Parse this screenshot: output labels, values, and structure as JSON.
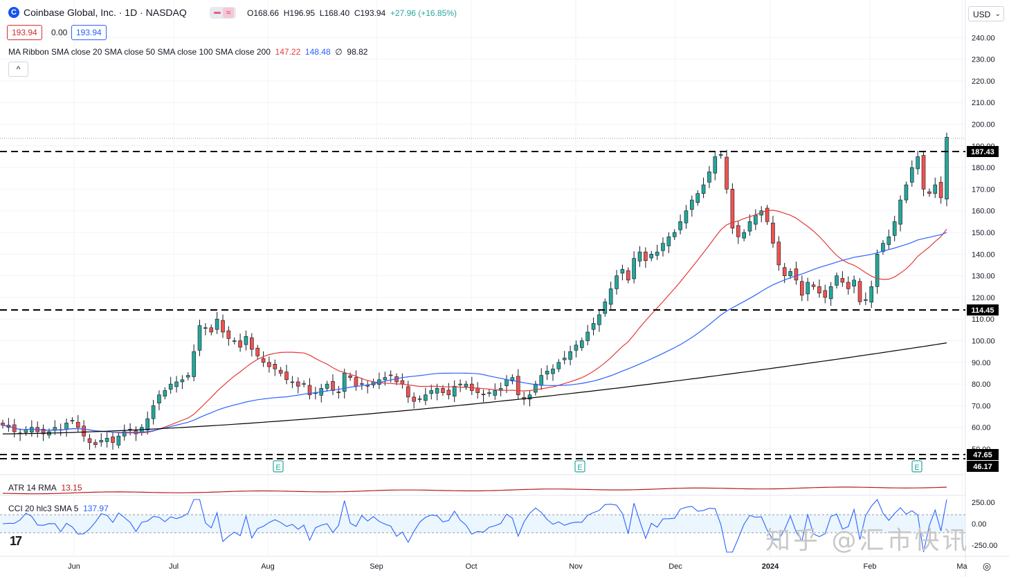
{
  "header": {
    "logo_glyph": "C",
    "symbol_title": "Coinbase Global, Inc. · 1D · NASDAQ",
    "ohlc": {
      "open_label": "O",
      "open": "168.66",
      "high_label": "H",
      "high": "196.95",
      "low_label": "L",
      "low": "168.40",
      "close_label": "C",
      "close": "193.94",
      "change": "+27.96 (+16.85%)"
    },
    "bid": "193.94",
    "spread": "0.00",
    "ask": "193.94",
    "ma_ribbon_label": "MA Ribbon SMA close 20 SMA close 50 SMA close 100 SMA close 200",
    "ma_values": [
      "147.22",
      "148.48",
      "∅",
      "98.82"
    ],
    "collapse_icon": "^",
    "currency": "USD"
  },
  "colors": {
    "up": "#26a69a",
    "down": "#ef5350",
    "sma20": "#e53935",
    "sma50": "#2962ff",
    "sma200": "#000000",
    "atr": "#b71c1c",
    "cci": "#2962ff"
  },
  "chart_data": {
    "type": "candlestick",
    "price_axis": {
      "ticks": [
        50,
        60,
        70,
        80,
        90,
        100,
        110,
        120,
        130,
        140,
        150,
        160,
        170,
        180,
        190,
        200,
        210,
        220,
        230,
        240
      ],
      "tick_labels": [
        "50.00",
        "60.00",
        "70.00",
        "80.00",
        "90.00",
        "100.00",
        "110.00",
        "120.00",
        "130.00",
        "140.00",
        "150.00",
        "160.00",
        "170.00",
        "180.00",
        "190.00",
        "200.00",
        "210.00",
        "220.00",
        "230.00",
        "240.00"
      ]
    },
    "time_axis": {
      "labels": [
        "Jun",
        "Jul",
        "Aug",
        "Sep",
        "Oct",
        "Nov",
        "Dec",
        "2024",
        "Feb",
        "Ma"
      ]
    },
    "horizontal_levels": [
      {
        "value": 187.43,
        "label": "187.43"
      },
      {
        "value": 114.45,
        "label": "114.45"
      },
      {
        "value": 47.65,
        "label": "47.65"
      },
      {
        "value": 46.17,
        "label": "46.17"
      }
    ],
    "earnings_markers": [
      "E",
      "E",
      "E"
    ],
    "candles_close": [
      61,
      60,
      58,
      57,
      59,
      60,
      58,
      57,
      58,
      60,
      59,
      62,
      63,
      60,
      56,
      53,
      52,
      54,
      55,
      53,
      56,
      58,
      59,
      57,
      60,
      64,
      70,
      75,
      77,
      80,
      81,
      82,
      84,
      95,
      107,
      106,
      104,
      110,
      104,
      101,
      100,
      97,
      102,
      96,
      93,
      90,
      88,
      87,
      85,
      82,
      81,
      79,
      80,
      75,
      76,
      78,
      80,
      77,
      76,
      85,
      83,
      79,
      80,
      79,
      81,
      82,
      83,
      84,
      81,
      80,
      74,
      72,
      73,
      75,
      77,
      78,
      76,
      75,
      79,
      80,
      80,
      77,
      76,
      75,
      76,
      77,
      78,
      82,
      83,
      75,
      73,
      75,
      80,
      84,
      86,
      87,
      90,
      92,
      95,
      98,
      100,
      104,
      108,
      112,
      118,
      124,
      130,
      133,
      128,
      138,
      141,
      137,
      140,
      141,
      145,
      148,
      150,
      155,
      160,
      165,
      168,
      172,
      178,
      185,
      186,
      170,
      152,
      148,
      150,
      155,
      158,
      160,
      155,
      145,
      135,
      130,
      132,
      128,
      121,
      127,
      125,
      122,
      120,
      125,
      130,
      127,
      124,
      128,
      118,
      119,
      125,
      140,
      145,
      148,
      155,
      165,
      172,
      180,
      185,
      170,
      168,
      172,
      166,
      194
    ],
    "sma20_visible": "147.22",
    "sma50_visible": "148.48",
    "sma200_visible": "98.82",
    "atr": {
      "label": "ATR 14 RMA",
      "value": "13.15"
    },
    "cci": {
      "label": "CCI 20 hlc3 SMA 5",
      "value": "137.97",
      "ticks": [
        "250.00",
        "0.00",
        "-250.00"
      ]
    }
  },
  "watermark": "知乎 @汇市快讯",
  "tv_logo": "17",
  "settings_icon": "◎"
}
